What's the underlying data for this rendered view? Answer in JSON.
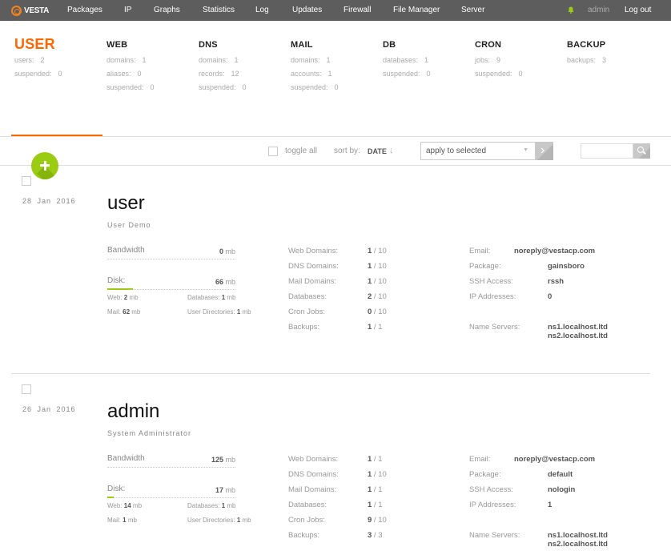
{
  "nav": {
    "logo": "VESTA",
    "items": [
      "Packages",
      "IP",
      "Graphs",
      "Statistics",
      "Log",
      "Updates",
      "Firewall",
      "File Manager",
      "Server"
    ],
    "user": "admin",
    "logout": "Log out",
    "accent": "#9acd12"
  },
  "stats": [
    {
      "title": "USER",
      "active": true,
      "rows": [
        {
          "k": "users:",
          "v": "2"
        },
        {
          "k": "suspended:",
          "v": "0"
        }
      ]
    },
    {
      "title": "WEB",
      "rows": [
        {
          "k": "domains:",
          "v": "1"
        },
        {
          "k": "aliases:",
          "v": "0"
        },
        {
          "k": "suspended:",
          "v": "0"
        }
      ]
    },
    {
      "title": "DNS",
      "rows": [
        {
          "k": "domains:",
          "v": "1"
        },
        {
          "k": "records:",
          "v": "12"
        },
        {
          "k": "suspended:",
          "v": "0"
        }
      ]
    },
    {
      "title": "MAIL",
      "rows": [
        {
          "k": "domains:",
          "v": "1"
        },
        {
          "k": "accounts:",
          "v": "1"
        },
        {
          "k": "suspended:",
          "v": "0"
        }
      ]
    },
    {
      "title": "DB",
      "rows": [
        {
          "k": "databases:",
          "v": "1"
        },
        {
          "k": "suspended:",
          "v": "0"
        }
      ]
    },
    {
      "title": "CRON",
      "rows": [
        {
          "k": "jobs:",
          "v": "9"
        },
        {
          "k": "suspended:",
          "v": "0"
        }
      ]
    },
    {
      "title": "BACKUP",
      "rows": [
        {
          "k": "backups:",
          "v": "3"
        }
      ]
    }
  ],
  "toolbar": {
    "toggle_all": "toggle all",
    "sort_by": "sort by:",
    "sort_value": "DATE",
    "sort_arrow": "↓",
    "apply_select": "apply to selected",
    "search_value": ""
  },
  "users": [
    {
      "date": "28 Jan 2016",
      "name": "user",
      "full_name": "User Demo",
      "bandwidth_label": "Bandwidth",
      "bandwidth": "0",
      "disk_label": "Disk:",
      "disk": "66",
      "disk_usage_fraction": 0.2,
      "unit": "mb",
      "web": "2",
      "databases": "1",
      "mail": "62",
      "user_dirs": "1",
      "limits": [
        {
          "k": "Web Domains:",
          "used": "1",
          "max": "10"
        },
        {
          "k": "DNS Domains:",
          "used": "1",
          "max": "10"
        },
        {
          "k": "Mail Domains:",
          "used": "1",
          "max": "10"
        },
        {
          "k": "Databases:",
          "used": "2",
          "max": "10"
        },
        {
          "k": "Cron Jobs:",
          "used": "0",
          "max": "10"
        },
        {
          "k": "Backups:",
          "used": "1",
          "max": "1"
        }
      ],
      "email": "noreply@vestacp.com",
      "package": "gainsboro",
      "ssh": "rssh",
      "ips": "0",
      "ns1": "ns1.localhost.ltd",
      "ns2": "ns2.localhost.ltd"
    },
    {
      "date": "26 Jan 2016",
      "name": "admin",
      "full_name": "System Administrator",
      "bandwidth_label": "Bandwidth",
      "bandwidth": "125",
      "disk_label": "Disk:",
      "disk": "17",
      "disk_usage_fraction": 0.05,
      "unit": "mb",
      "web": "14",
      "databases": "1",
      "mail": "1",
      "user_dirs": "1",
      "limits": [
        {
          "k": "Web Domains:",
          "used": "1",
          "max": "1"
        },
        {
          "k": "DNS Domains:",
          "used": "1",
          "max": "10"
        },
        {
          "k": "Mail Domains:",
          "used": "1",
          "max": "1"
        },
        {
          "k": "Databases:",
          "used": "1",
          "max": "1"
        },
        {
          "k": "Cron Jobs:",
          "used": "9",
          "max": "10"
        },
        {
          "k": "Backups:",
          "used": "3",
          "max": "3"
        }
      ],
      "email": "noreply@vestacp.com",
      "package": "default",
      "ssh": "nologin",
      "ips": "1",
      "ns1": "ns1.localhost.ltd",
      "ns2": "ns2.localhost.ltd"
    }
  ],
  "labels": {
    "web": "Web:",
    "databases": "Databases:",
    "mail": "Mail:",
    "user_dirs": "User Directories:",
    "email": "Email:",
    "package": "Package:",
    "ssh": "SSH Access:",
    "ips": "IP Addresses:",
    "ns": "Name Servers:"
  }
}
